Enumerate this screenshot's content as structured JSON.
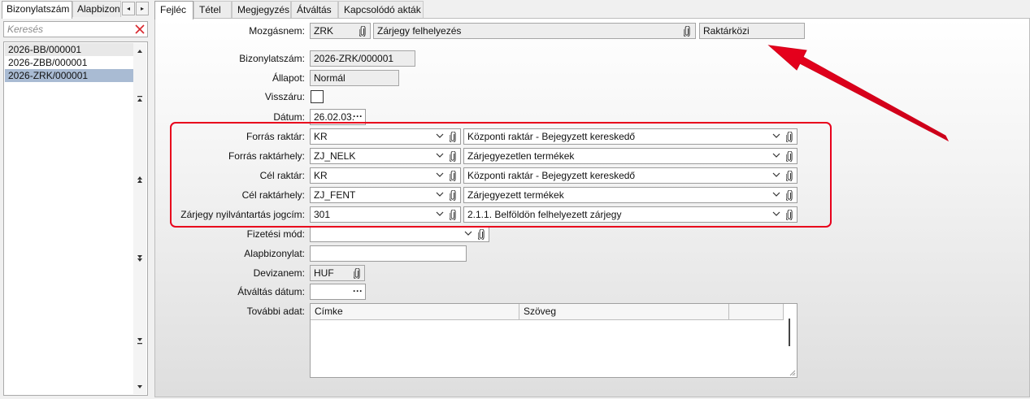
{
  "left_panel": {
    "tabs": [
      {
        "label": "Bizonylatszám",
        "active": true
      },
      {
        "label": "Alapbizonylat",
        "active": false
      }
    ],
    "nav_prev_glyph": "◂",
    "nav_next_glyph": "▸",
    "search": {
      "placeholder": "Keresés",
      "value": ""
    },
    "clear_icon": "close-icon",
    "items": [
      {
        "label": "2026-BB/000001",
        "selected": false
      },
      {
        "label": "2026-ZBB/000001",
        "selected": false
      },
      {
        "label": "2026-ZRK/000001",
        "selected": true
      }
    ]
  },
  "main_tabs": [
    {
      "label": "Fejléc",
      "active": true
    },
    {
      "label": "Tétel",
      "active": false
    },
    {
      "label": "Megjegyzés",
      "active": false
    },
    {
      "label": "Átváltás",
      "active": false
    },
    {
      "label": "Kapcsolódó akták",
      "active": false
    }
  ],
  "form": {
    "mozgasnem": {
      "label": "Mozgásnem:",
      "code": "ZRK",
      "name": "Zárjegy felhelyezés",
      "type": "Raktárközi"
    },
    "bizonylatszam": {
      "label": "Bizonylatszám:",
      "value": "2026-ZRK/000001"
    },
    "allapot": {
      "label": "Állapot:",
      "value": "Normál"
    },
    "visszaru": {
      "label": "Visszáru:",
      "checked": false
    },
    "datum": {
      "label": "Dátum:",
      "value": "26.02.03.",
      "button": "···"
    },
    "forras_raktar": {
      "label": "Forrás raktár:",
      "code": "KR",
      "name": "Központi raktár - Bejegyzett kereskedő"
    },
    "forras_raktarhely": {
      "label": "Forrás raktárhely:",
      "code": "ZJ_NELK",
      "name": "Zárjegyezetlen termékek"
    },
    "cel_raktar": {
      "label": "Cél raktár:",
      "code": "KR",
      "name": "Központi raktár - Bejegyzett kereskedő"
    },
    "cel_raktarhely": {
      "label": "Cél raktárhely:",
      "code": "ZJ_FENT",
      "name": "Zárjegyezett termékek"
    },
    "zarjegy_jogcim": {
      "label": "Zárjegy nyilvántartás  jogcím:",
      "code": "301",
      "name": "2.1.1. Belföldön felhelyezett zárjegy"
    },
    "fizetesi_mod": {
      "label": "Fizetési mód:",
      "value": ""
    },
    "alapbizonylat": {
      "label": "Alapbizonylat:",
      "value": ""
    },
    "devizanem": {
      "label": "Devizanem:",
      "value": "HUF"
    },
    "atvaltas_datum": {
      "label": "Átváltás dátum:",
      "value": "",
      "button": "···"
    },
    "tovabbi_adat": {
      "label": "További adat:",
      "columns": [
        "Címke",
        "Szöveg",
        ""
      ]
    }
  },
  "colors": {
    "highlight": "#e8001c",
    "selection": "#a9bbd3",
    "arrow": "#e8001c"
  }
}
